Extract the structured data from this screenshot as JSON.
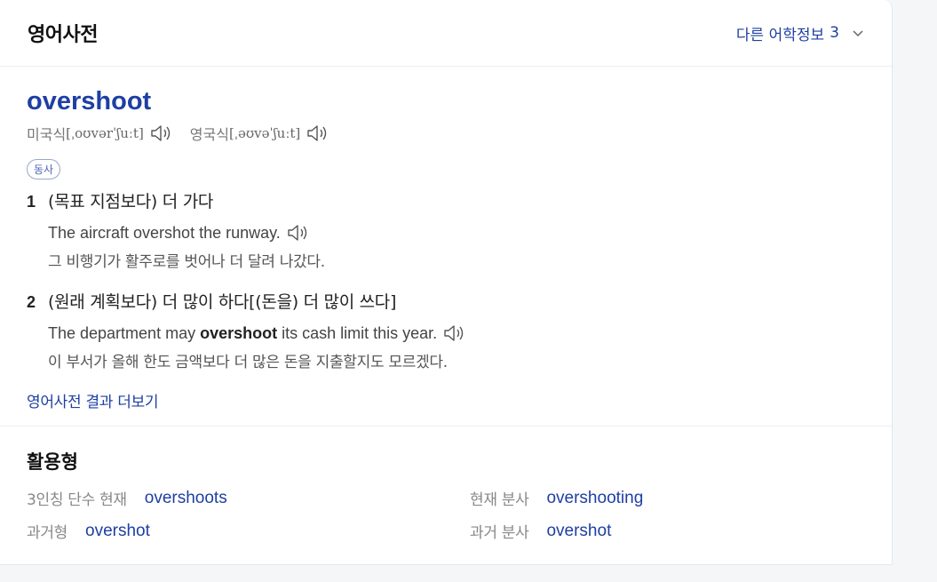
{
  "header": {
    "title": "영어사전",
    "more_label": "다른 어학정보",
    "more_count": "3"
  },
  "entry": {
    "word": "overshoot",
    "pron_us_label": "미국식",
    "pron_us_ipa": "[ˌoʊvərˈʃuːt]",
    "pron_uk_label": "영국식",
    "pron_uk_ipa": "[ˌəʊvəˈʃuːt]",
    "pos": "동사",
    "definitions": [
      {
        "num": "1",
        "text": "(목표 지점보다) 더 가다",
        "example_en": "The aircraft overshot the runway.",
        "example_ko": "그 비행기가 활주로를 벗어나 더 달려 나갔다."
      },
      {
        "num": "2",
        "text": "(원래 계획보다) 더 많이 하다[(돈을) 더 많이 쓰다]",
        "example_en_pre": "The department may ",
        "example_en_bold": "overshoot",
        "example_en_post": " its cash limit this year.",
        "example_ko": "이 부서가 올해 한도 금액보다 더 많은 돈을 지출할지도 모르겠다."
      }
    ],
    "more_link": "영어사전 결과 더보기"
  },
  "inflections": {
    "title": "활용형",
    "items": [
      {
        "label": "3인칭 단수 현재",
        "value": "overshoots"
      },
      {
        "label": "현재 분사",
        "value": "overshooting"
      },
      {
        "label": "과거형",
        "value": "overshot"
      },
      {
        "label": "과거 분사",
        "value": "overshot"
      }
    ]
  },
  "icons": {
    "speaker": "speaker-icon",
    "chevron": "chevron-down-icon"
  },
  "colors": {
    "accent": "#1e3fa3",
    "muted": "#888888"
  }
}
